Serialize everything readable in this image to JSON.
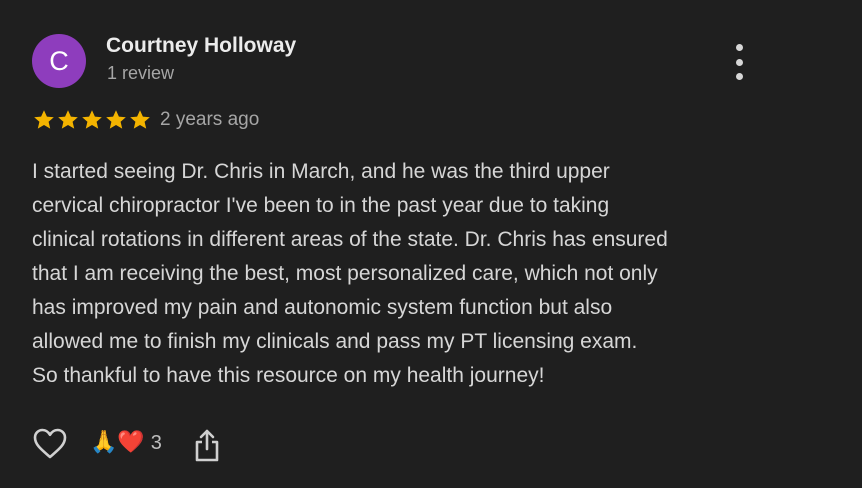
{
  "review": {
    "avatar_initial": "C",
    "avatar_color": "#8e3dbd",
    "author_name": "Courtney Holloway",
    "review_count": "1 review",
    "rating": 5,
    "max_rating": 5,
    "time_ago": "2 years ago",
    "text_lines": [
      "I started seeing Dr. Chris in March, and he was the third upper",
      "cervical chiropractor I've been to in the past year due to taking",
      "clinical rotations in different areas of the state. Dr. Chris has ensured",
      "that I am receiving the best, most personalized care, which not only",
      "has improved my pain and autonomic system function but also",
      "allowed me to finish my clinicals and pass my PT licensing exam.",
      "So thankful to have this resource on my health journey!"
    ],
    "reactions": {
      "emojis": "🙏❤️",
      "count": "3"
    },
    "icons": {
      "more": "more-vert-icon",
      "like": "heart-outline-icon",
      "share": "share-icon",
      "star": "star-icon"
    },
    "colors": {
      "star": "#f4b400",
      "background": "#1f1f1f"
    }
  }
}
